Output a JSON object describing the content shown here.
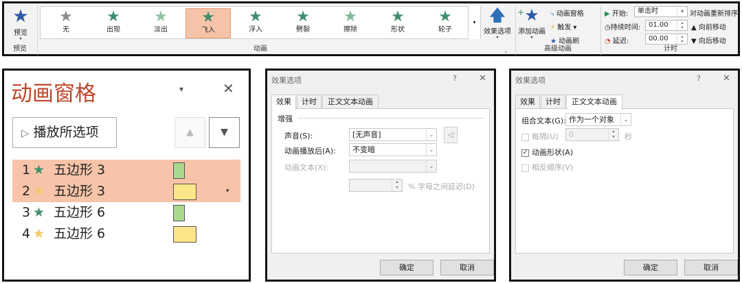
{
  "ribbon": {
    "preview_label": "预览",
    "preview_group": "预览",
    "animation_group": "动画",
    "gallery": [
      {
        "label": "无",
        "icon": "star-none-icon",
        "color": "#8c8c8c"
      },
      {
        "label": "出现",
        "icon": "star-appear-icon",
        "color": "#3e8e6c"
      },
      {
        "label": "淡出",
        "icon": "star-fade-icon",
        "color": "#8fc4a6"
      },
      {
        "label": "飞入",
        "icon": "star-fly-icon",
        "color": "#3e8e6c",
        "selected": true
      },
      {
        "label": "浮入",
        "icon": "star-float-icon",
        "color": "#3e8e6c"
      },
      {
        "label": "劈裂",
        "icon": "star-split-icon",
        "color": "#3e8e6c"
      },
      {
        "label": "擦除",
        "icon": "star-wipe-icon",
        "color": "#7fb99a"
      },
      {
        "label": "形状",
        "icon": "star-shape-icon",
        "color": "#3e8e6c"
      },
      {
        "label": "轮子",
        "icon": "star-wheel-icon",
        "color": "#3e8e6c"
      }
    ],
    "effect_options": "效果选项",
    "add_animation": "添加动画",
    "anim_pane": "动画窗格",
    "trigger": "触发",
    "anim_painter": "动画刷",
    "advanced_group": "高级动画",
    "start_label": "开始:",
    "start_value": "单击时",
    "duration_label": "持续时间:",
    "duration_value": "01.00",
    "delay_label": "延迟:",
    "delay_value": "00.00",
    "timing_group": "计时",
    "reorder_title": "对动画重新排序",
    "move_earlier": "向前移动",
    "move_later": "向后移动"
  },
  "pane": {
    "title": "动画窗格",
    "play_selected": "播放所选项",
    "items": [
      {
        "num": "1",
        "star_color": "#3e8e6c",
        "name": "五边形 3",
        "swatch": "#a9d98e",
        "selected": true
      },
      {
        "num": "2",
        "star_color": "#f2c965",
        "name": "五边形 3",
        "swatch": "#fde58a",
        "selected": true
      },
      {
        "num": "3",
        "star_color": "#3e8e6c",
        "name": "五边形 6",
        "swatch": "#a9d98e",
        "selected": false
      },
      {
        "num": "4",
        "star_color": "#f2c965",
        "name": "五边形 6",
        "swatch": "#fde58a",
        "selected": false
      }
    ]
  },
  "dialog1": {
    "title": "效果选项",
    "help": "?",
    "tabs": [
      "效果",
      "计时",
      "正文文本动画"
    ],
    "section": "增强",
    "sound_label": "声音(S):",
    "sound_value": "[无声音]",
    "after_label": "动画播放后(A):",
    "after_value": "不变暗",
    "text_label": "动画文本(X):",
    "text_value": "",
    "delay_suffix": "% 字母之间延迟(D)",
    "ok": "确定",
    "cancel": "取消"
  },
  "dialog2": {
    "title": "效果选项",
    "help": "?",
    "tabs": [
      "效果",
      "计时",
      "正文文本动画"
    ],
    "group_label": "组合文本(G):",
    "group_value": "作为一个对象",
    "every_label": "每隔(U)",
    "every_value": "0",
    "sec": "秒",
    "animate_shape": "动画形状(A)",
    "reverse": "相反顺序(V)",
    "ok": "确定",
    "cancel": "取消"
  }
}
